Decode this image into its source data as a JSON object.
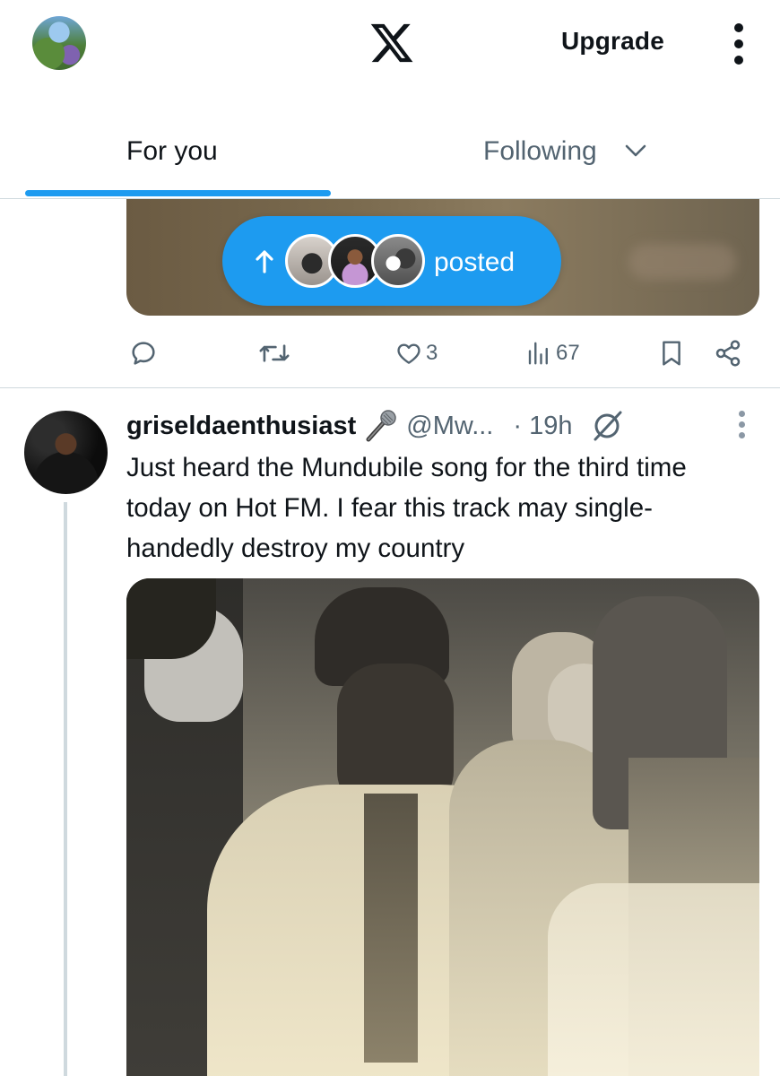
{
  "header": {
    "logo_icon": "x-logo-icon",
    "upgrade_label": "Upgrade",
    "more_icon": "kebab-vertical-icon"
  },
  "tabs": [
    {
      "label": "For you",
      "active": true
    },
    {
      "label": "Following",
      "active": false
    }
  ],
  "posted_pill": {
    "arrow_icon": "arrow-up-icon",
    "label": "posted",
    "color": "#1d9bf0"
  },
  "previous_tweet_actions": {
    "reply_count": "",
    "retweet_count": "",
    "like_count": "3",
    "view_count": "67"
  },
  "tweet": {
    "display_name": "griseldaenthusiast",
    "name_emoji": "microphone-icon",
    "handle": "@Mw...",
    "time": "· 19h",
    "text": "Just heard the Mundubile song for the third time today on Hot FM. I fear this track may single-handedly destroy my country"
  },
  "colors": {
    "accent": "#1d9bf0",
    "text_primary": "#0f1419",
    "text_secondary": "#536471",
    "divider": "#cfd9de"
  }
}
